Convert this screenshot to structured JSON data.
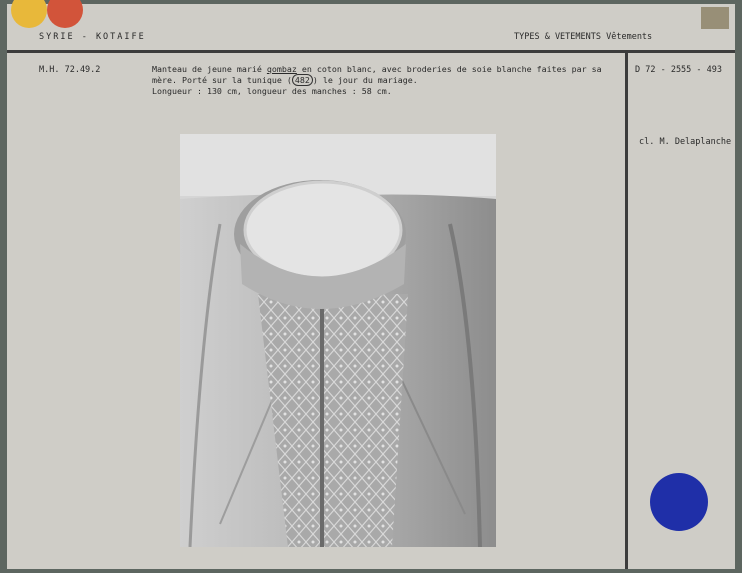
{
  "header": {
    "location": "SYRIE  -  KOTAIFE",
    "category": "TYPES & VETEMENTS Vêtements"
  },
  "record": {
    "inventory_number": "M.H. 72.49.2",
    "description_part1": "Manteau de jeune marié ",
    "description_keyword": "qombaz",
    "description_part2": " en coton blanc, avec broderies de soie blanche faites par sa",
    "description_line2_a": "mère. Porté sur la tunique (",
    "description_ref": "482",
    "description_line2_b": ") le jour du mariage.",
    "dimensions": "Longueur : 130 cm, longueur des manches : 58 cm.",
    "photo_ref": "D  72 - 2555 - 493",
    "photo_credit": "cl. M. Delaplanche"
  },
  "colors": {
    "card": "#cfcdc7",
    "marker_blue": "#1f2fa8",
    "tab_yellow": "#e8b83a",
    "tab_red": "#d2543a"
  }
}
